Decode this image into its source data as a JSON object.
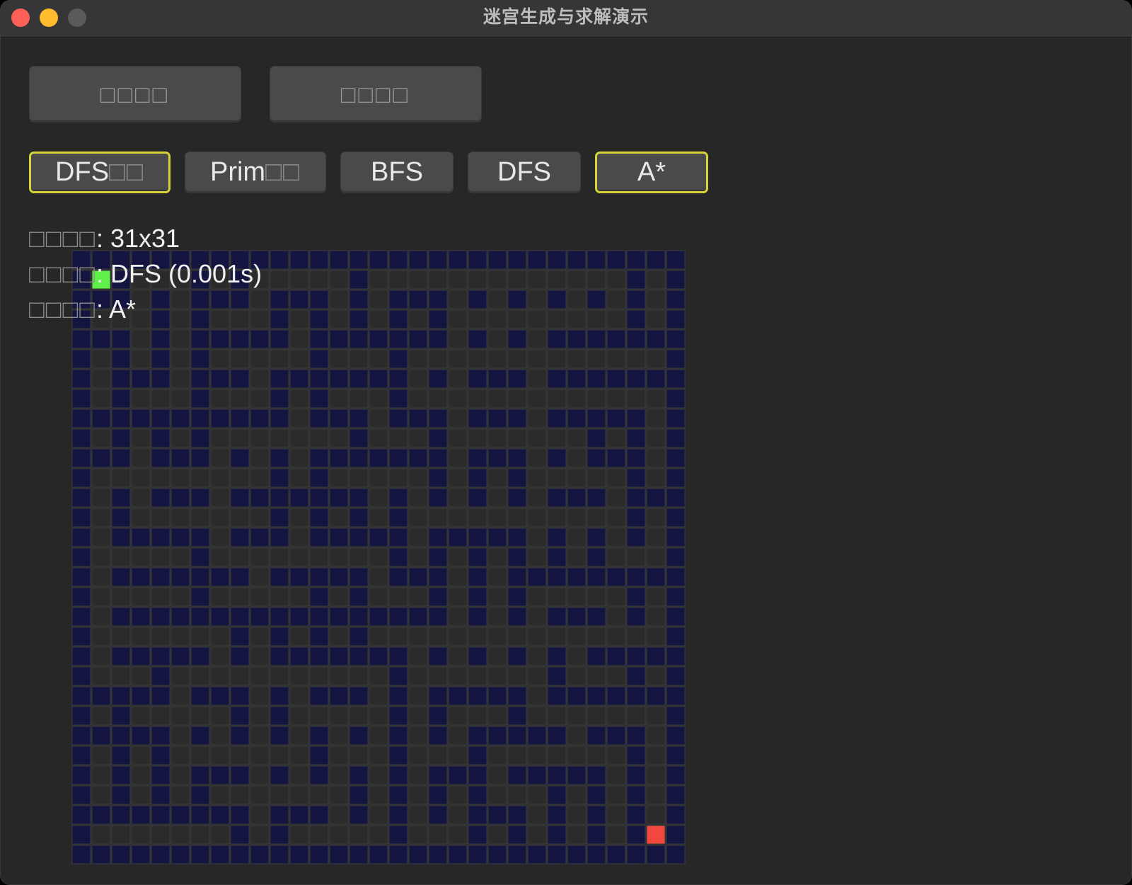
{
  "window": {
    "title": "迷宫生成与求解演示"
  },
  "toolbar": {
    "primary_buttons": [
      {
        "label": "□□□□"
      },
      {
        "label": "□□□□"
      }
    ],
    "algorithm_buttons": [
      {
        "text": "DFS",
        "boxes": "□□",
        "selected": true
      },
      {
        "text": "Prim",
        "boxes": "□□",
        "selected": false
      },
      {
        "text": "BFS",
        "boxes": "",
        "selected": false
      },
      {
        "text": "DFS",
        "boxes": "",
        "selected": false
      },
      {
        "text": "A*",
        "boxes": "",
        "selected": true
      }
    ]
  },
  "info": {
    "size_label": "□□□□",
    "size_value": ": 31x31",
    "generation_label": "□□□□",
    "generation_value": ": DFS (0.001s)",
    "solver_label": "□□□□",
    "solver_value": ": A*"
  },
  "maze": {
    "rows": 31,
    "cols": 31,
    "start": [
      1,
      1
    ],
    "goal": [
      29,
      29
    ],
    "colors": {
      "wall": "#131540",
      "path": "#2b2b2b",
      "start": "#5ff04a",
      "goal": "#f0473e",
      "grid": "#3b3b3b"
    }
  }
}
